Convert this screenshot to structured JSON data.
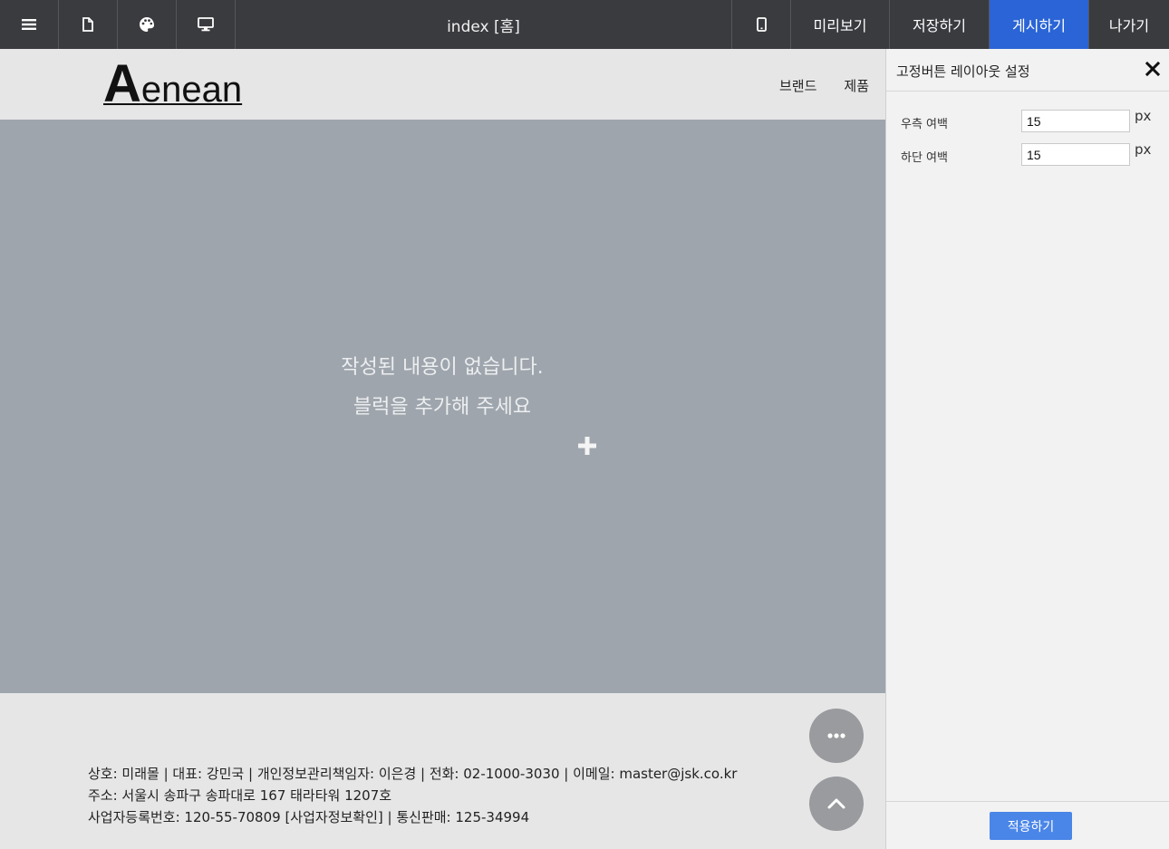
{
  "toolbar": {
    "menu_icon": "hamburger-menu-icon",
    "page_icon": "document-icon",
    "theme_icon": "palette-icon",
    "desktop_icon": "desktop-monitor-icon",
    "title": "index [홈]",
    "mobile_icon": "mobile-phone-icon",
    "preview": "미리보기",
    "save": "저장하기",
    "publish": "게시하기",
    "exit": "나가기",
    "publish_color": "#2a64d6"
  },
  "site": {
    "logo_first": "A",
    "logo_rest": "enean",
    "nav": [
      "브랜드",
      "제품"
    ]
  },
  "content": {
    "empty_line1": "작성된 내용이 없습니다.",
    "empty_line2": "블럭을 추가해 주세요",
    "add_icon": "plus-icon"
  },
  "footer": {
    "line1": "상호: 미래몰 | 대표: 강민국 | 개인정보관리책임자: 이은경 | 전화: 02-1000-3030 | 이메일: master@jsk.co.kr",
    "line2": "주소: 서울시 송파구 송파대로 167 태라타워 1207호",
    "line3": "사업자등록번호: 120-55-70809 [사업자정보확인] | 통신판매: 125-34994",
    "more_icon": "more-dots-icon",
    "top_icon": "chevron-up-icon"
  },
  "panel": {
    "title": "고정버튼 레이아웃 설정",
    "close_icon": "close-icon",
    "fields": [
      {
        "label": "우측 여백",
        "value": "15",
        "unit": "px"
      },
      {
        "label": "하단 여백",
        "value": "15",
        "unit": "px"
      }
    ],
    "apply": "적용하기",
    "apply_color": "#4a86e8"
  }
}
